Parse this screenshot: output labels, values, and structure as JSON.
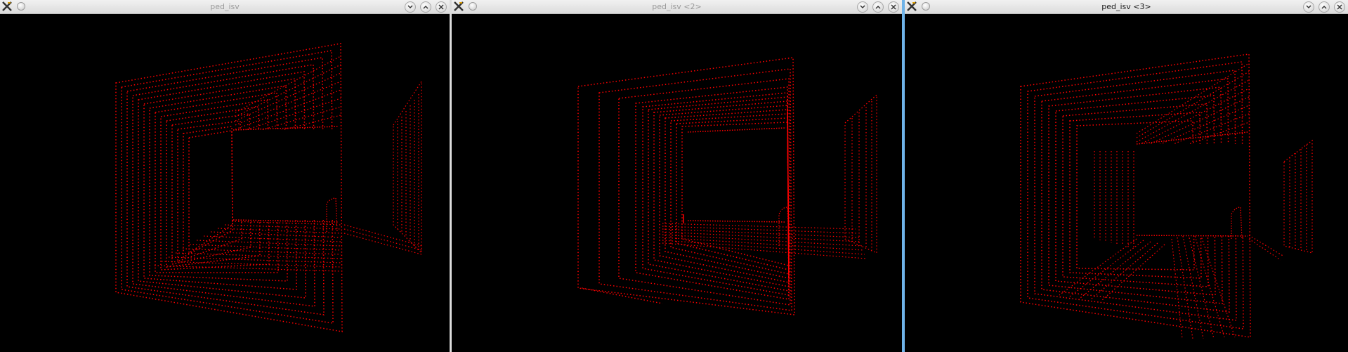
{
  "windows": [
    {
      "title": "ped_isv",
      "active": false
    },
    {
      "title": "ped_isv <2>",
      "active": false
    },
    {
      "title": "ped_isv <3>",
      "active": true
    }
  ],
  "icons": {
    "app": "x-app-icon",
    "sticky": "circle-icon",
    "minimize": "chevron-down-icon",
    "maximize": "chevron-up-icon",
    "close": "close-icon"
  },
  "colors": {
    "point_cloud": "#ff0000",
    "background": "#000000",
    "active_border": "#6fb3e8"
  }
}
